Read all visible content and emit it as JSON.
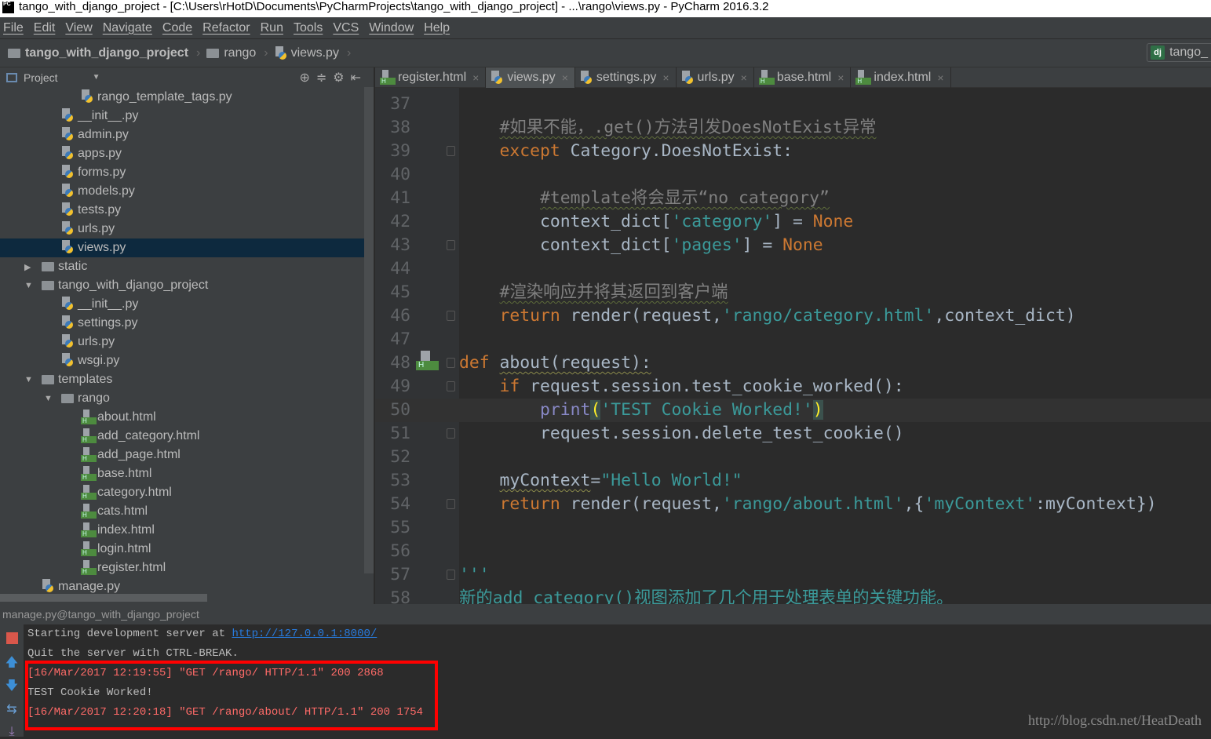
{
  "window": {
    "title": "tango_with_django_project - [C:\\Users\\rHotD\\Documents\\PyCharmProjects\\tango_with_django_project] - ...\\rango\\views.py - PyCharm 2016.3.2",
    "logo": "PC"
  },
  "menu": [
    "File",
    "Edit",
    "View",
    "Navigate",
    "Code",
    "Refactor",
    "Run",
    "Tools",
    "VCS",
    "Window",
    "Help"
  ],
  "breadcrumb": [
    "tango_with_django_project",
    "rango",
    "views.py"
  ],
  "run_config": {
    "icon": "dj",
    "label": "tango_"
  },
  "project_panel": {
    "title": "Project",
    "selected": "views.py"
  },
  "tree": [
    {
      "label": "rango_template_tags.py",
      "type": "py",
      "level": 4
    },
    {
      "label": "__init__.py",
      "type": "py",
      "level": 3
    },
    {
      "label": "admin.py",
      "type": "py",
      "level": 3
    },
    {
      "label": "apps.py",
      "type": "py",
      "level": 3
    },
    {
      "label": "forms.py",
      "type": "py",
      "level": 3
    },
    {
      "label": "models.py",
      "type": "py",
      "level": 3
    },
    {
      "label": "tests.py",
      "type": "py",
      "level": 3
    },
    {
      "label": "urls.py",
      "type": "py",
      "level": 3
    },
    {
      "label": "views.py",
      "type": "py",
      "level": 3,
      "selected": true
    },
    {
      "label": "static",
      "type": "folder",
      "level": 2,
      "expanded": false
    },
    {
      "label": "tango_with_django_project",
      "type": "folder",
      "level": 2,
      "expanded": true
    },
    {
      "label": "__init__.py",
      "type": "py",
      "level": 3
    },
    {
      "label": "settings.py",
      "type": "py",
      "level": 3
    },
    {
      "label": "urls.py",
      "type": "py",
      "level": 3
    },
    {
      "label": "wsgi.py",
      "type": "py",
      "level": 3
    },
    {
      "label": "templates",
      "type": "folder",
      "level": 2,
      "expanded": true
    },
    {
      "label": "rango",
      "type": "folder",
      "level": 3,
      "expanded": true
    },
    {
      "label": "about.html",
      "type": "html",
      "level": 4
    },
    {
      "label": "add_category.html",
      "type": "html",
      "level": 4
    },
    {
      "label": "add_page.html",
      "type": "html",
      "level": 4
    },
    {
      "label": "base.html",
      "type": "html",
      "level": 4
    },
    {
      "label": "category.html",
      "type": "html",
      "level": 4
    },
    {
      "label": "cats.html",
      "type": "html",
      "level": 4
    },
    {
      "label": "index.html",
      "type": "html",
      "level": 4
    },
    {
      "label": "login.html",
      "type": "html",
      "level": 4
    },
    {
      "label": "register.html",
      "type": "html",
      "level": 4
    },
    {
      "label": "manage.py",
      "type": "py",
      "level": 2
    }
  ],
  "tabs": [
    {
      "label": "register.html",
      "type": "html"
    },
    {
      "label": "views.py",
      "type": "py",
      "active": true
    },
    {
      "label": "settings.py",
      "type": "py"
    },
    {
      "label": "urls.py",
      "type": "py"
    },
    {
      "label": "base.html",
      "type": "html"
    },
    {
      "label": "index.html",
      "type": "html"
    }
  ],
  "editor": {
    "current_line": 50,
    "lines": [
      {
        "n": "37",
        "t": []
      },
      {
        "n": "38",
        "t": [
          [
            "plain",
            "    "
          ],
          [
            "cmt",
            "#如果不能，.get()方法引发DoesNotExist异常"
          ]
        ]
      },
      {
        "n": "39",
        "fold": true,
        "t": [
          [
            "plain",
            "    "
          ],
          [
            "kw",
            "except"
          ],
          [
            "plain",
            " Category.DoesNotExist:"
          ]
        ]
      },
      {
        "n": "40",
        "t": []
      },
      {
        "n": "41",
        "t": [
          [
            "plain",
            "        "
          ],
          [
            "cmt",
            "#template将会显示“no category”"
          ]
        ]
      },
      {
        "n": "42",
        "t": [
          [
            "plain",
            "        context_dict["
          ],
          [
            "str",
            "'category'"
          ],
          [
            "plain",
            "] = "
          ],
          [
            "kw",
            "None"
          ]
        ]
      },
      {
        "n": "43",
        "fold": true,
        "t": [
          [
            "plain",
            "        context_dict["
          ],
          [
            "str",
            "'pages'"
          ],
          [
            "plain",
            "] = "
          ],
          [
            "kw",
            "None"
          ]
        ]
      },
      {
        "n": "44",
        "t": []
      },
      {
        "n": "45",
        "t": [
          [
            "plain",
            "    "
          ],
          [
            "cmt",
            "#渲染响应并将其返回到客户端"
          ]
        ]
      },
      {
        "n": "46",
        "fold": true,
        "t": [
          [
            "plain",
            "    "
          ],
          [
            "kw",
            "return"
          ],
          [
            "plain",
            " render(request,"
          ],
          [
            "str",
            "'rango/category.html'"
          ],
          [
            "plain",
            ",context_dict)"
          ]
        ]
      },
      {
        "n": "47",
        "t": []
      },
      {
        "n": "48",
        "fold": true,
        "t": [
          [
            "kw",
            "def"
          ],
          [
            "plain",
            " "
          ],
          [
            "warn",
            "about(request):"
          ]
        ]
      },
      {
        "n": "49",
        "fold": true,
        "t": [
          [
            "plain",
            "    "
          ],
          [
            "kw",
            "if"
          ],
          [
            "plain",
            " request.session.test_cookie_worked():"
          ]
        ]
      },
      {
        "n": "50",
        "t": [
          [
            "plain",
            "        "
          ],
          [
            "bi",
            "print"
          ],
          [
            "paren",
            "("
          ],
          [
            "str",
            "'TEST Cookie Worked!'"
          ],
          [
            "paren",
            ")"
          ]
        ]
      },
      {
        "n": "51",
        "fold": true,
        "t": [
          [
            "plain",
            "        request.session.delete_test_cookie()"
          ]
        ]
      },
      {
        "n": "52",
        "t": []
      },
      {
        "n": "53",
        "t": [
          [
            "plain",
            "    "
          ],
          [
            "warn",
            "myContext"
          ],
          [
            "plain",
            "="
          ],
          [
            "str",
            "\"Hello World!\""
          ]
        ]
      },
      {
        "n": "54",
        "fold": true,
        "t": [
          [
            "plain",
            "    "
          ],
          [
            "kw",
            "return"
          ],
          [
            "plain",
            " render(request,"
          ],
          [
            "str",
            "'rango/about.html'"
          ],
          [
            "plain",
            ",{"
          ],
          [
            "str",
            "'myContext'"
          ],
          [
            "plain",
            ":myContext})"
          ]
        ]
      },
      {
        "n": "55",
        "t": []
      },
      {
        "n": "56",
        "t": []
      },
      {
        "n": "57",
        "fold": true,
        "t": [
          [
            "doc",
            "'''"
          ]
        ]
      },
      {
        "n": "58",
        "t": [
          [
            "doc",
            "新的add_category()视图添加了几个用于处理表单的关键功能。"
          ]
        ]
      }
    ]
  },
  "run_panel": {
    "title": "manage.py@tango_with_django_project",
    "lines": [
      {
        "text": "Starting development server at ",
        "link": "http://127.0.0.1:8000/",
        "kind": "normal"
      },
      {
        "text": "Quit the server with CTRL-BREAK.",
        "kind": "normal"
      },
      {
        "text": "[16/Mar/2017 12:19:55] \"GET /rango/ HTTP/1.1\" 200 2868",
        "kind": "err"
      },
      {
        "text": "TEST Cookie Worked!",
        "kind": "normal"
      },
      {
        "text": "[16/Mar/2017 12:20:18] \"GET /rango/about/ HTTP/1.1\" 200 1754",
        "kind": "err"
      }
    ]
  },
  "watermark": "http://blog.csdn.net/HeatDeath"
}
